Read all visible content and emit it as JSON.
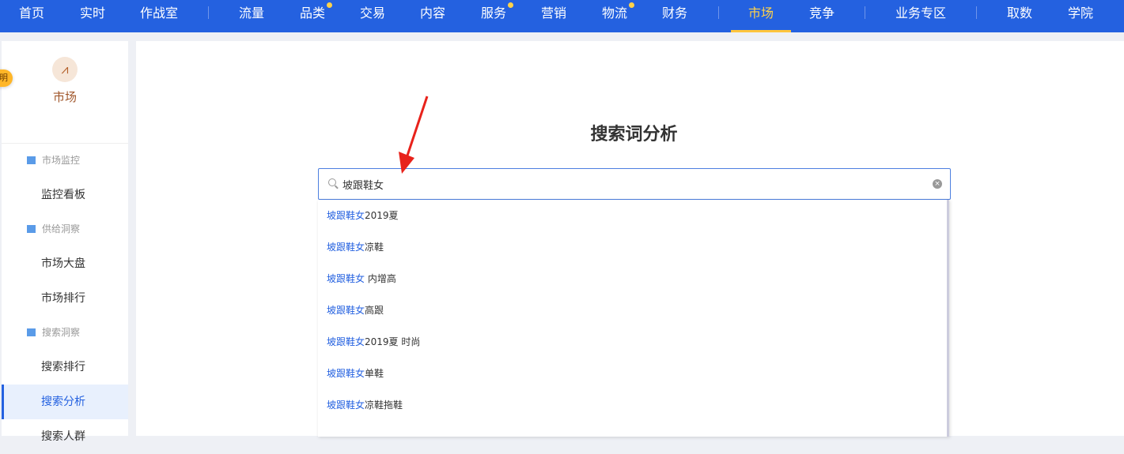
{
  "nav": {
    "items": [
      {
        "label": "首页"
      },
      {
        "label": "实时"
      },
      {
        "label": "作战室"
      },
      {
        "label": "流量"
      },
      {
        "label": "品类",
        "dot": true
      },
      {
        "label": "交易"
      },
      {
        "label": "内容"
      },
      {
        "label": "服务",
        "dot": true
      },
      {
        "label": "营销"
      },
      {
        "label": "物流",
        "dot": true
      },
      {
        "label": "财务"
      },
      {
        "label": "市场",
        "active": true
      },
      {
        "label": "竞争"
      },
      {
        "label": "业务专区"
      },
      {
        "label": "取数"
      },
      {
        "label": "学院"
      }
    ]
  },
  "sidebar": {
    "title": "市场",
    "logo_glyph": "📈",
    "badge": "明",
    "groups": [
      {
        "label": "市场监控",
        "items": [
          "监控看板"
        ]
      },
      {
        "label": "供给洞察",
        "items": [
          "市场大盘",
          "市场排行"
        ]
      },
      {
        "label": "搜索洞察",
        "items": [
          "搜索排行",
          "搜索分析",
          "搜索人群"
        ]
      }
    ],
    "active": "搜索分析"
  },
  "main": {
    "title": "搜索词分析",
    "search_value": "坡跟鞋女",
    "suggestions": [
      {
        "hl": "坡跟鞋女",
        "rest": "2019夏"
      },
      {
        "hl": "坡跟鞋女",
        "rest": "凉鞋"
      },
      {
        "hl": "坡跟鞋女",
        "rest": " 内增高"
      },
      {
        "hl": "坡跟鞋女",
        "rest": "高跟"
      },
      {
        "hl": "坡跟鞋女",
        "rest": "2019夏 时尚"
      },
      {
        "hl": "坡跟鞋女",
        "rest": "单鞋"
      },
      {
        "hl": "坡跟鞋女",
        "rest": "凉鞋拖鞋"
      }
    ]
  },
  "colors": {
    "brand": "#2461e0",
    "active_nav": "#ffd24a",
    "annotation_arrow": "#e8221b"
  }
}
